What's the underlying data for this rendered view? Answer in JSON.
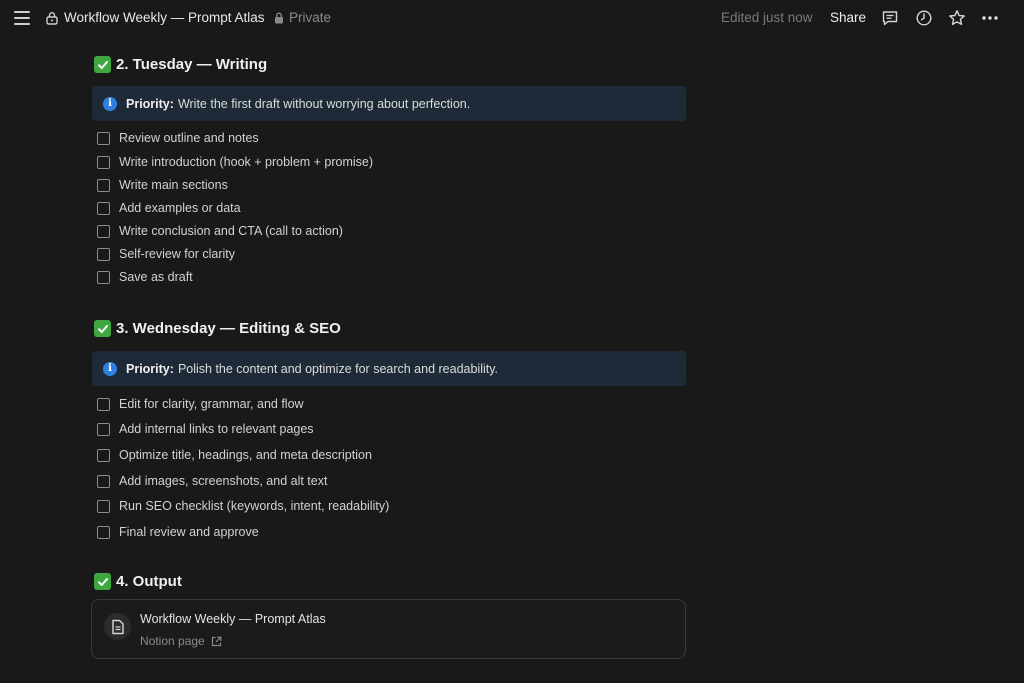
{
  "topbar": {
    "title": "Workflow Weekly — Prompt Atlas",
    "private_label": "Private",
    "edited_label": "Edited just now",
    "share_label": "Share"
  },
  "sections": [
    {
      "heading": "2. Tuesday — Writing",
      "callout": {
        "label": "Priority:",
        "text": "Write the first draft without worrying about perfection."
      },
      "todos": [
        "Review outline and notes",
        "Write introduction (hook + problem + promise)",
        "Write main sections",
        "Add examples or data",
        "Write conclusion and CTA (call to action)",
        "Self-review for clarity",
        "Save as draft"
      ]
    },
    {
      "heading": "3. Wednesday — Editing & SEO",
      "callout": {
        "label": "Priority:",
        "text": "Polish the content and optimize for search and readability."
      },
      "todos": [
        "Edit for clarity, grammar, and flow",
        "Add internal links to relevant pages",
        "Optimize title, headings, and meta description",
        "Add images, screenshots, and alt text",
        "Run SEO checklist (keywords, intent, readability)",
        "Final review and approve"
      ]
    },
    {
      "heading": "4. Output"
    }
  ],
  "link_card": {
    "title": "Workflow Weekly — Prompt Atlas",
    "subtitle": "Notion page"
  },
  "colors": {
    "background": "#191919",
    "callout_bg": "#1e2a37",
    "check_green": "#3fa73f",
    "info_blue": "#2f7fe0"
  }
}
